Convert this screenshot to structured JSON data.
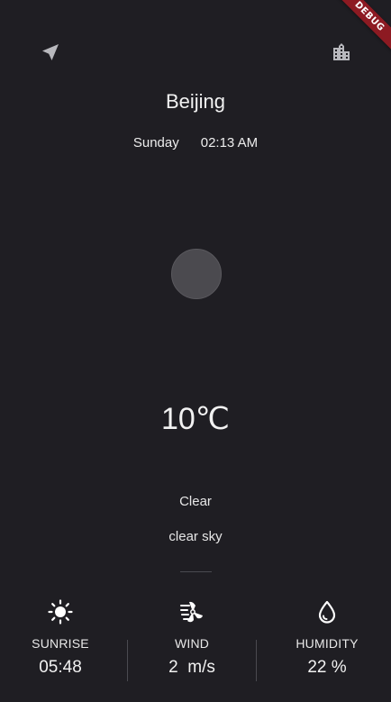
{
  "header": {
    "location_icon": "navigation-arrow-icon",
    "city_icon": "location-city-icon",
    "debug_banner": "DEBUG"
  },
  "weather": {
    "city": "Beijing",
    "day": "Sunday",
    "time": "02:13 AM",
    "weather_icon": "loading-circle",
    "temperature": "10℃",
    "condition": "Clear",
    "description": "clear sky"
  },
  "stats": {
    "sunrise": {
      "icon": "sun-icon",
      "label": "SUNRISE",
      "value": "05:48"
    },
    "wind": {
      "icon": "wind-icon",
      "label": "WIND",
      "value": "2  m/s"
    },
    "humidity": {
      "icon": "water-drop-icon",
      "label": "HUMIDITY",
      "value": "22 %"
    }
  },
  "colors": {
    "background": "#1f1e23",
    "text": "#f2f2f2",
    "icon_gray": "#b8b8bd",
    "circle": "#4b4a4f",
    "debug_ribbon": "#8d1a22"
  }
}
